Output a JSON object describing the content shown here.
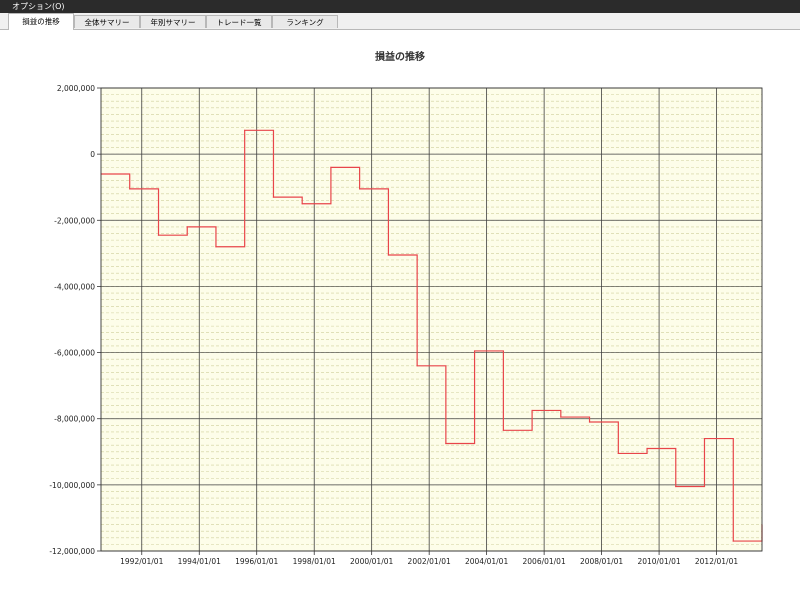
{
  "window": {
    "menu_label": "オプション(O)"
  },
  "tabs": [
    {
      "label": "損益の推移",
      "active": true
    },
    {
      "label": "全体サマリー",
      "active": false
    },
    {
      "label": "年別サマリー",
      "active": false
    },
    {
      "label": "トレード一覧",
      "active": false
    },
    {
      "label": "ランキング",
      "active": false
    }
  ],
  "colors": {
    "plot_background": "#fdfde9",
    "line": "#e8454a",
    "grid_major": "#404040",
    "grid_minor": "#cfcf9a"
  },
  "chart_data": {
    "type": "line",
    "title": "損益の推移",
    "xlabel": "",
    "ylabel": "",
    "xlim": [
      "1990/08/01",
      "2013/08/01"
    ],
    "ylim": [
      -12000000,
      2000000
    ],
    "y_ticks": [
      2000000,
      0,
      -2000000,
      -4000000,
      -6000000,
      -8000000,
      -10000000,
      -12000000
    ],
    "y_tick_labels": [
      "2,000,000",
      "0",
      "-2,000,000",
      "-4,000,000",
      "-6,000,000",
      "-8,000,000",
      "-10,000,000",
      "-12,000,000"
    ],
    "x_ticks": [
      "1992/01/01",
      "1994/01/01",
      "1996/01/01",
      "1998/01/01",
      "2000/01/01",
      "2002/01/01",
      "2004/01/01",
      "2006/01/01",
      "2008/01/01",
      "2010/01/01",
      "2012/01/01"
    ],
    "x_tick_labels": [
      "1992/01/01",
      "1994/01/01",
      "1996/01/01",
      "1998/01/01",
      "2000/01/01",
      "2002/01/01",
      "2004/01/01",
      "2006/01/01",
      "2008/01/01",
      "2010/01/01",
      "2012/01/01"
    ],
    "grid": true,
    "step": true,
    "series": [
      {
        "x": [
          "1990/08/01",
          "1991/08/01",
          "1992/08/01",
          "1993/08/01",
          "1994/08/01",
          "1995/08/01",
          "1996/08/01",
          "1997/08/01",
          "1998/08/01",
          "1999/08/01",
          "2000/08/01",
          "2001/08/01",
          "2002/08/01",
          "2003/08/01",
          "2004/08/01",
          "2005/08/01",
          "2006/08/01",
          "2007/08/01",
          "2008/08/01",
          "2009/08/01",
          "2010/08/01",
          "2011/08/01",
          "2012/08/01"
        ],
        "values": [
          -600000,
          -1050000,
          -2450000,
          -2200000,
          -2800000,
          720000,
          -1300000,
          -1500000,
          -400000,
          -1050000,
          -3050000,
          -6400000,
          -8750000,
          -5950000,
          -8350000,
          -7750000,
          -7950000,
          -8100000,
          -9050000,
          -8900000,
          -10050000,
          -8600000,
          -11700000
        ]
      }
    ],
    "end_value": -11200000
  }
}
